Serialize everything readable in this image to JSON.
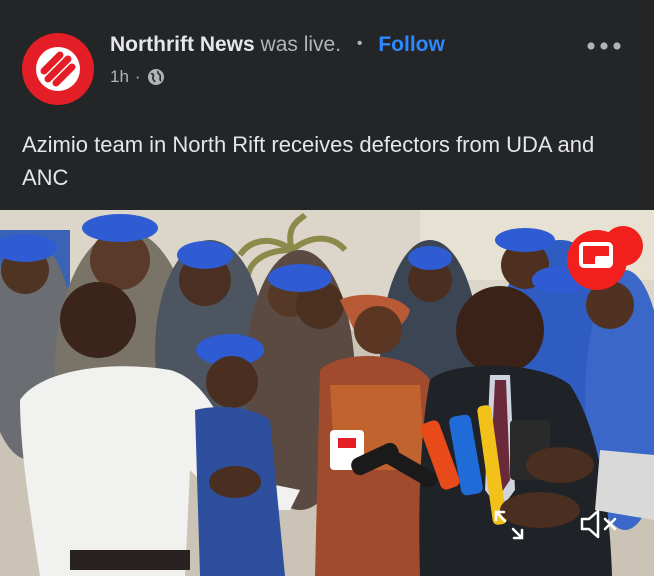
{
  "post": {
    "page_name": "Northrift News",
    "live_text": "was live.",
    "separator": "•",
    "follow_label": "Follow",
    "time": "1h",
    "meta_sep": "·",
    "privacy_icon": "globe-icon",
    "more_icon": "more-options-icon",
    "caption": "Azimio team in North Rift receives defectors from UDA and ANC"
  },
  "video": {
    "pip_icon": "picture-in-picture-icon",
    "fullscreen_icon": "expand-icon",
    "mute_icon": "speaker-muted-icon"
  },
  "colors": {
    "background": "#242526",
    "brand": "#e41e26",
    "follow": "#2d88ff",
    "cap_blue": "#2f5bd3"
  }
}
